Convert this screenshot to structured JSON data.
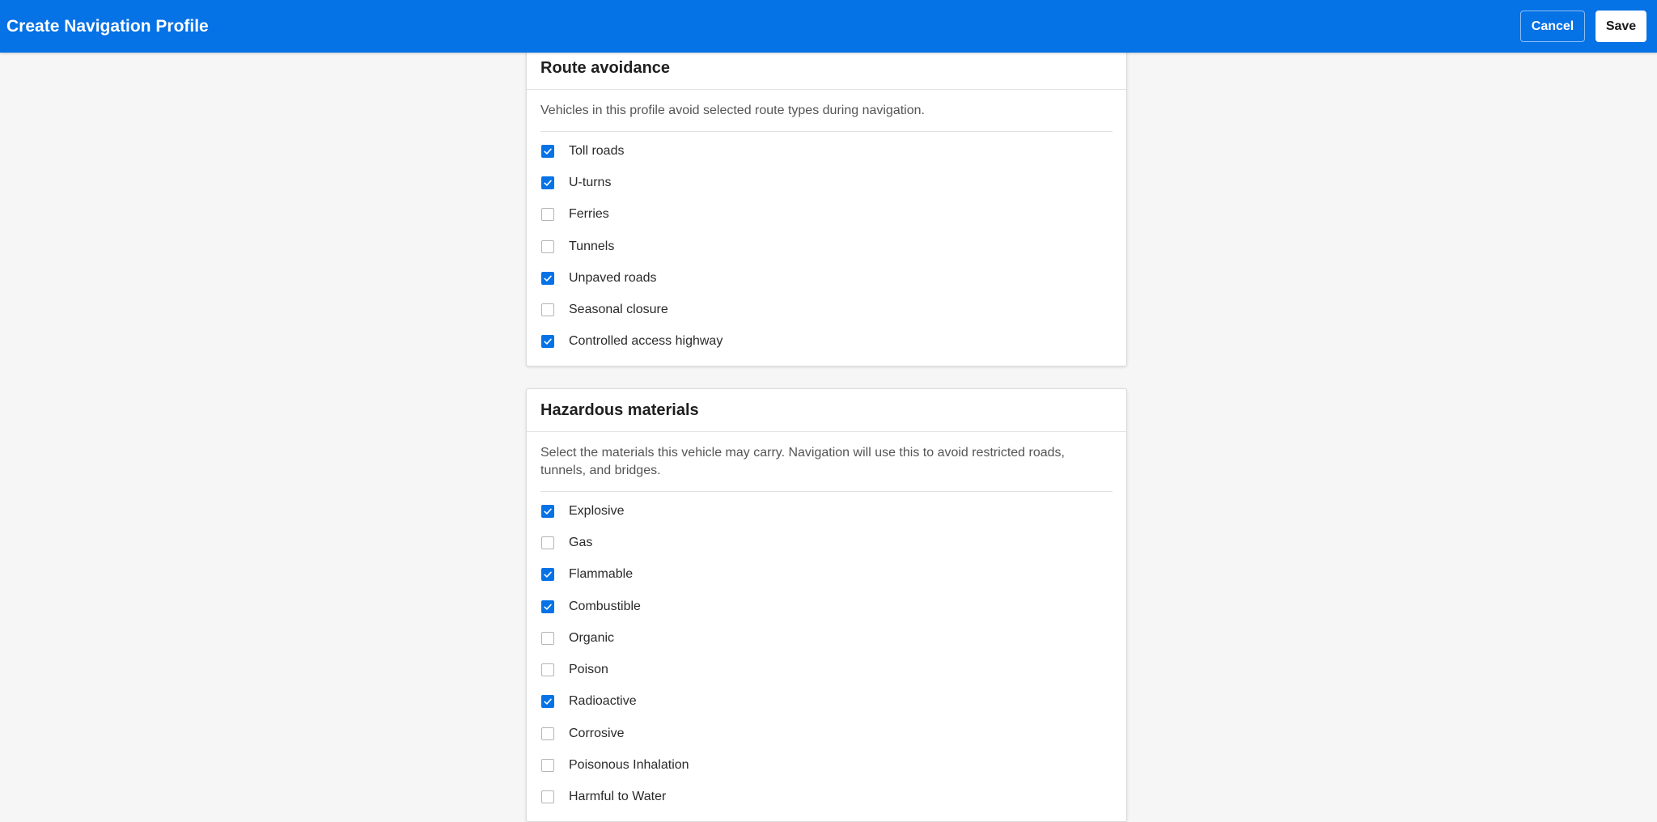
{
  "header": {
    "title": "Create Navigation Profile",
    "cancel_label": "Cancel",
    "save_label": "Save"
  },
  "colors": {
    "header_bg": "#0572e6",
    "checkbox_checked": "#0572e6",
    "page_bg": "#f6f6f6"
  },
  "route_avoidance": {
    "title": "Route avoidance",
    "description": "Vehicles in this profile avoid selected route types during navigation.",
    "options": [
      {
        "label": "Toll roads",
        "checked": true
      },
      {
        "label": "U-turns",
        "checked": true
      },
      {
        "label": "Ferries",
        "checked": false
      },
      {
        "label": "Tunnels",
        "checked": false
      },
      {
        "label": "Unpaved roads",
        "checked": true
      },
      {
        "label": "Seasonal closure",
        "checked": false
      },
      {
        "label": "Controlled access highway",
        "checked": true
      }
    ]
  },
  "hazardous_materials": {
    "title": "Hazardous materials",
    "description": "Select the materials this vehicle may carry. Navigation will use this to avoid restricted roads, tunnels, and bridges.",
    "options": [
      {
        "label": "Explosive",
        "checked": true
      },
      {
        "label": "Gas",
        "checked": false
      },
      {
        "label": "Flammable",
        "checked": true
      },
      {
        "label": "Combustible",
        "checked": true
      },
      {
        "label": "Organic",
        "checked": false
      },
      {
        "label": "Poison",
        "checked": false
      },
      {
        "label": "Radioactive",
        "checked": true
      },
      {
        "label": "Corrosive",
        "checked": false
      },
      {
        "label": "Poisonous Inhalation",
        "checked": false
      },
      {
        "label": "Harmful to Water",
        "checked": false
      }
    ]
  }
}
